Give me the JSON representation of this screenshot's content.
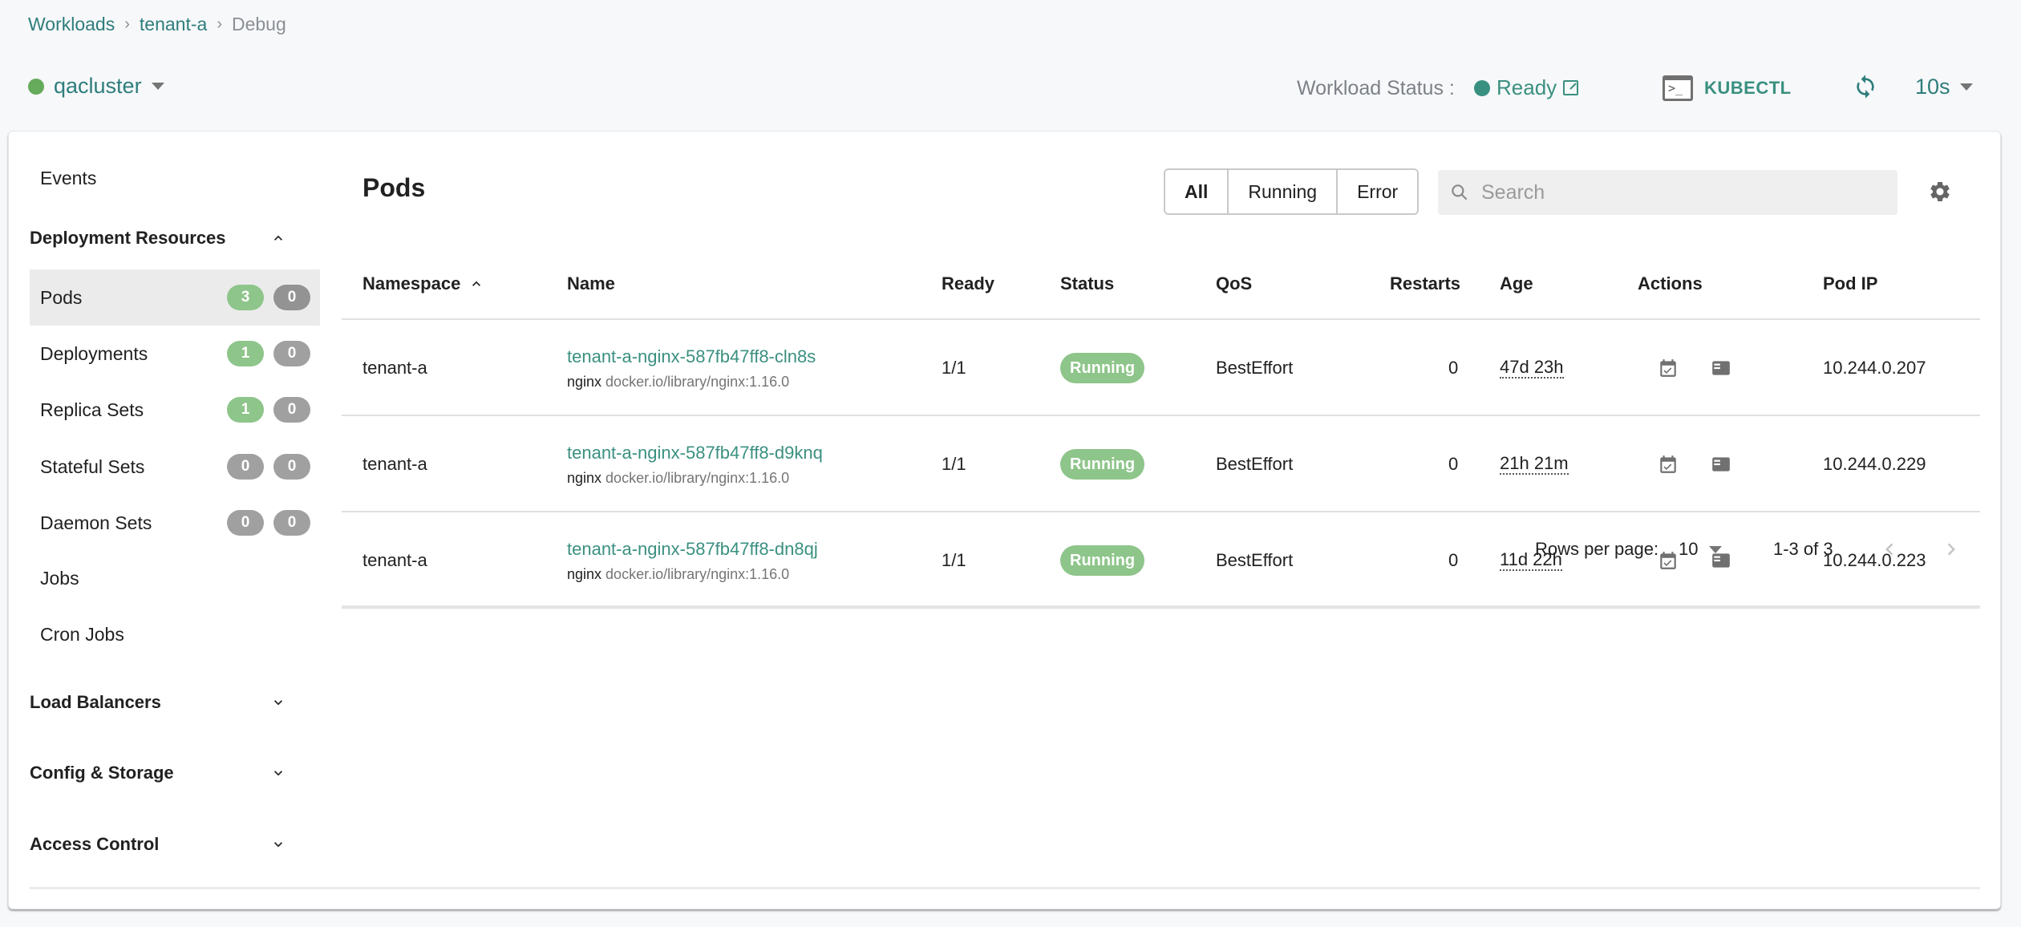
{
  "breadcrumb": {
    "items": [
      "Workloads",
      "tenant-a"
    ],
    "current": "Debug"
  },
  "cluster": {
    "name": "qacluster",
    "status_color": "#66aa5b"
  },
  "header": {
    "workload_status_label": "Workload Status :",
    "workload_status_value": "Ready",
    "kubectl_label": "KUBECTL",
    "refresh_interval": "10s",
    "accent_color": "#3a9080"
  },
  "sidebar": {
    "events_label": "Events",
    "sections": [
      {
        "label": "Deployment Resources",
        "expanded": true
      },
      {
        "label": "Load Balancers",
        "expanded": false
      },
      {
        "label": "Config & Storage",
        "expanded": false
      },
      {
        "label": "Access Control",
        "expanded": false
      }
    ],
    "items": [
      {
        "label": "Pods",
        "ok": "3",
        "err": "0",
        "active": true
      },
      {
        "label": "Deployments",
        "ok": "1",
        "err": "0"
      },
      {
        "label": "Replica Sets",
        "ok": "1",
        "err": "0"
      },
      {
        "label": "Stateful Sets",
        "ok": "0",
        "err": "0"
      },
      {
        "label": "Daemon Sets",
        "ok": "0",
        "err": "0"
      },
      {
        "label": "Jobs"
      },
      {
        "label": "Cron Jobs"
      }
    ]
  },
  "main": {
    "title": "Pods",
    "filters": [
      "All",
      "Running",
      "Error"
    ],
    "active_filter": "All",
    "search_placeholder": "Search",
    "columns": [
      "Namespace",
      "Name",
      "Ready",
      "Status",
      "QoS",
      "Restarts",
      "Age",
      "Actions",
      "Pod IP"
    ],
    "rows": [
      {
        "namespace": "tenant-a",
        "name": "tenant-a-nginx-587fb47ff8-cln8s",
        "container": "nginx",
        "image": "docker.io/library/nginx:1.16.0",
        "ready": "1/1",
        "status": "Running",
        "qos": "BestEffort",
        "restarts": "0",
        "age": "47d 23h",
        "ip": "10.244.0.207"
      },
      {
        "namespace": "tenant-a",
        "name": "tenant-a-nginx-587fb47ff8-d9knq",
        "container": "nginx",
        "image": "docker.io/library/nginx:1.16.0",
        "ready": "1/1",
        "status": "Running",
        "qos": "BestEffort",
        "restarts": "0",
        "age": "21h 21m",
        "ip": "10.244.0.229"
      },
      {
        "namespace": "tenant-a",
        "name": "tenant-a-nginx-587fb47ff8-dn8qj",
        "container": "nginx",
        "image": "docker.io/library/nginx:1.16.0",
        "ready": "1/1",
        "status": "Running",
        "qos": "BestEffort",
        "restarts": "0",
        "age": "11d 22h",
        "ip": "10.244.0.223"
      }
    ],
    "pagination": {
      "rows_per_page_label": "Rows per page:",
      "rows_per_page": "10",
      "range": "1-3 of 3"
    }
  }
}
